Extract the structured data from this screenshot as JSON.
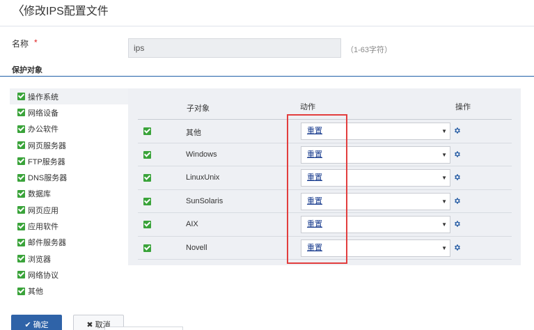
{
  "header": {
    "title": "修改IPS配置文件",
    "back_glyph": "〈"
  },
  "form": {
    "name_label": "名称",
    "required_mark": "*",
    "name_value": "ips",
    "name_hint": "（1-63字符）"
  },
  "section": {
    "title": "保护对象"
  },
  "tree": {
    "items": [
      {
        "label": "操作系统",
        "checked": true,
        "selected": true
      },
      {
        "label": "网络设备",
        "checked": true
      },
      {
        "label": "办公软件",
        "checked": true
      },
      {
        "label": "网页服务器",
        "checked": true
      },
      {
        "label": "FTP服务器",
        "checked": true
      },
      {
        "label": "DNS服务器",
        "checked": true
      },
      {
        "label": "数据库",
        "checked": true
      },
      {
        "label": "网页应用",
        "checked": true
      },
      {
        "label": "应用软件",
        "checked": true
      },
      {
        "label": "邮件服务器",
        "checked": true
      },
      {
        "label": "浏览器",
        "checked": true
      },
      {
        "label": "网络协议",
        "checked": true
      },
      {
        "label": "其他",
        "checked": true
      }
    ]
  },
  "table": {
    "headers": {
      "sub_object": "子对象",
      "action": "动作",
      "operation": "操作"
    },
    "rows": [
      {
        "name": "其他",
        "action": "重置",
        "checked": true
      },
      {
        "name": "Windows",
        "action": "重置",
        "checked": true
      },
      {
        "name": "LinuxUnix",
        "action": "重置",
        "checked": true
      },
      {
        "name": "SunSolaris",
        "action": "重置",
        "checked": true
      },
      {
        "name": "AIX",
        "action": "重置",
        "checked": true
      },
      {
        "name": "Novell",
        "action": "重置",
        "checked": true
      }
    ]
  },
  "buttons": {
    "ok_label": "确定",
    "cancel_label": "取消"
  },
  "colors": {
    "accent": "#2f63a8",
    "checkbox": "#3aa33a",
    "highlight": "#e23d3d"
  }
}
